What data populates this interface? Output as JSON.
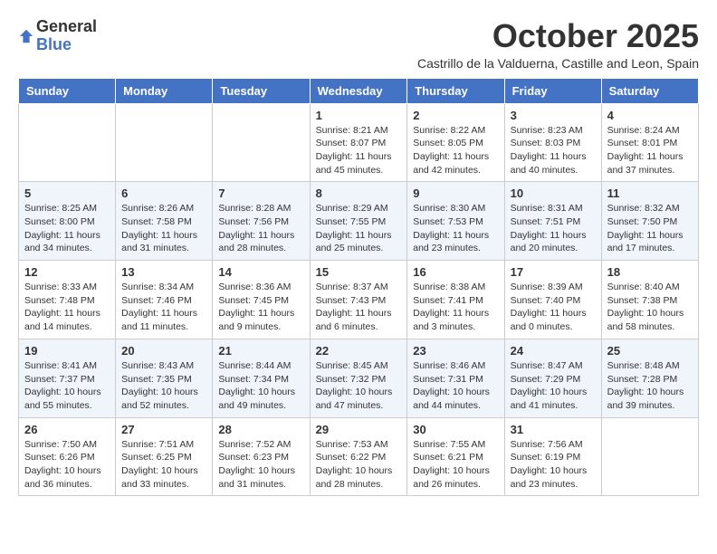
{
  "logo": {
    "general": "General",
    "blue": "Blue"
  },
  "title": "October 2025",
  "subtitle": "Castrillo de la Valduerna, Castille and Leon, Spain",
  "days": [
    "Sunday",
    "Monday",
    "Tuesday",
    "Wednesday",
    "Thursday",
    "Friday",
    "Saturday"
  ],
  "weeks": [
    [
      {
        "day": "",
        "info": ""
      },
      {
        "day": "",
        "info": ""
      },
      {
        "day": "",
        "info": ""
      },
      {
        "day": "1",
        "info": "Sunrise: 8:21 AM\nSunset: 8:07 PM\nDaylight: 11 hours and 45 minutes."
      },
      {
        "day": "2",
        "info": "Sunrise: 8:22 AM\nSunset: 8:05 PM\nDaylight: 11 hours and 42 minutes."
      },
      {
        "day": "3",
        "info": "Sunrise: 8:23 AM\nSunset: 8:03 PM\nDaylight: 11 hours and 40 minutes."
      },
      {
        "day": "4",
        "info": "Sunrise: 8:24 AM\nSunset: 8:01 PM\nDaylight: 11 hours and 37 minutes."
      }
    ],
    [
      {
        "day": "5",
        "info": "Sunrise: 8:25 AM\nSunset: 8:00 PM\nDaylight: 11 hours and 34 minutes."
      },
      {
        "day": "6",
        "info": "Sunrise: 8:26 AM\nSunset: 7:58 PM\nDaylight: 11 hours and 31 minutes."
      },
      {
        "day": "7",
        "info": "Sunrise: 8:28 AM\nSunset: 7:56 PM\nDaylight: 11 hours and 28 minutes."
      },
      {
        "day": "8",
        "info": "Sunrise: 8:29 AM\nSunset: 7:55 PM\nDaylight: 11 hours and 25 minutes."
      },
      {
        "day": "9",
        "info": "Sunrise: 8:30 AM\nSunset: 7:53 PM\nDaylight: 11 hours and 23 minutes."
      },
      {
        "day": "10",
        "info": "Sunrise: 8:31 AM\nSunset: 7:51 PM\nDaylight: 11 hours and 20 minutes."
      },
      {
        "day": "11",
        "info": "Sunrise: 8:32 AM\nSunset: 7:50 PM\nDaylight: 11 hours and 17 minutes."
      }
    ],
    [
      {
        "day": "12",
        "info": "Sunrise: 8:33 AM\nSunset: 7:48 PM\nDaylight: 11 hours and 14 minutes."
      },
      {
        "day": "13",
        "info": "Sunrise: 8:34 AM\nSunset: 7:46 PM\nDaylight: 11 hours and 11 minutes."
      },
      {
        "day": "14",
        "info": "Sunrise: 8:36 AM\nSunset: 7:45 PM\nDaylight: 11 hours and 9 minutes."
      },
      {
        "day": "15",
        "info": "Sunrise: 8:37 AM\nSunset: 7:43 PM\nDaylight: 11 hours and 6 minutes."
      },
      {
        "day": "16",
        "info": "Sunrise: 8:38 AM\nSunset: 7:41 PM\nDaylight: 11 hours and 3 minutes."
      },
      {
        "day": "17",
        "info": "Sunrise: 8:39 AM\nSunset: 7:40 PM\nDaylight: 11 hours and 0 minutes."
      },
      {
        "day": "18",
        "info": "Sunrise: 8:40 AM\nSunset: 7:38 PM\nDaylight: 10 hours and 58 minutes."
      }
    ],
    [
      {
        "day": "19",
        "info": "Sunrise: 8:41 AM\nSunset: 7:37 PM\nDaylight: 10 hours and 55 minutes."
      },
      {
        "day": "20",
        "info": "Sunrise: 8:43 AM\nSunset: 7:35 PM\nDaylight: 10 hours and 52 minutes."
      },
      {
        "day": "21",
        "info": "Sunrise: 8:44 AM\nSunset: 7:34 PM\nDaylight: 10 hours and 49 minutes."
      },
      {
        "day": "22",
        "info": "Sunrise: 8:45 AM\nSunset: 7:32 PM\nDaylight: 10 hours and 47 minutes."
      },
      {
        "day": "23",
        "info": "Sunrise: 8:46 AM\nSunset: 7:31 PM\nDaylight: 10 hours and 44 minutes."
      },
      {
        "day": "24",
        "info": "Sunrise: 8:47 AM\nSunset: 7:29 PM\nDaylight: 10 hours and 41 minutes."
      },
      {
        "day": "25",
        "info": "Sunrise: 8:48 AM\nSunset: 7:28 PM\nDaylight: 10 hours and 39 minutes."
      }
    ],
    [
      {
        "day": "26",
        "info": "Sunrise: 7:50 AM\nSunset: 6:26 PM\nDaylight: 10 hours and 36 minutes."
      },
      {
        "day": "27",
        "info": "Sunrise: 7:51 AM\nSunset: 6:25 PM\nDaylight: 10 hours and 33 minutes."
      },
      {
        "day": "28",
        "info": "Sunrise: 7:52 AM\nSunset: 6:23 PM\nDaylight: 10 hours and 31 minutes."
      },
      {
        "day": "29",
        "info": "Sunrise: 7:53 AM\nSunset: 6:22 PM\nDaylight: 10 hours and 28 minutes."
      },
      {
        "day": "30",
        "info": "Sunrise: 7:55 AM\nSunset: 6:21 PM\nDaylight: 10 hours and 26 minutes."
      },
      {
        "day": "31",
        "info": "Sunrise: 7:56 AM\nSunset: 6:19 PM\nDaylight: 10 hours and 23 minutes."
      },
      {
        "day": "",
        "info": ""
      }
    ]
  ]
}
